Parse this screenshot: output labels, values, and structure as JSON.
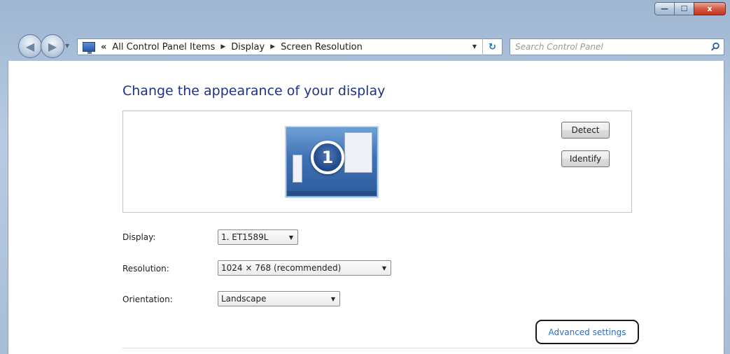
{
  "window": {
    "minimize_glyph": "—",
    "maximize_glyph": "☐",
    "close_glyph": "x"
  },
  "navbar": {
    "back_glyph": "◀",
    "forward_glyph": "▶",
    "overflow_glyph": "«",
    "breadcrumbs": [
      "All Control Panel Items",
      "Display",
      "Screen Resolution"
    ],
    "breadcrumb_separator": "▶",
    "dropdown_glyph": "▼",
    "refresh_glyph": "↻",
    "search_placeholder": "Search Control Panel"
  },
  "main": {
    "title": "Change the appearance of your display",
    "monitor_number": "1",
    "detect_label": "Detect",
    "identify_label": "Identify",
    "fields": {
      "display": {
        "label": "Display:",
        "value": "1. ET1589L"
      },
      "resolution": {
        "label": "Resolution:",
        "value": "1024 × 768 (recommended)"
      },
      "orientation": {
        "label": "Orientation:",
        "value": "Landscape"
      }
    },
    "caret_glyph": "▼",
    "advanced_link": "Advanced settings"
  },
  "colors": {
    "title": "#1e3287",
    "link": "#2c6bc1",
    "frame": "#b8cbe2",
    "close_button": "#c0361c"
  }
}
